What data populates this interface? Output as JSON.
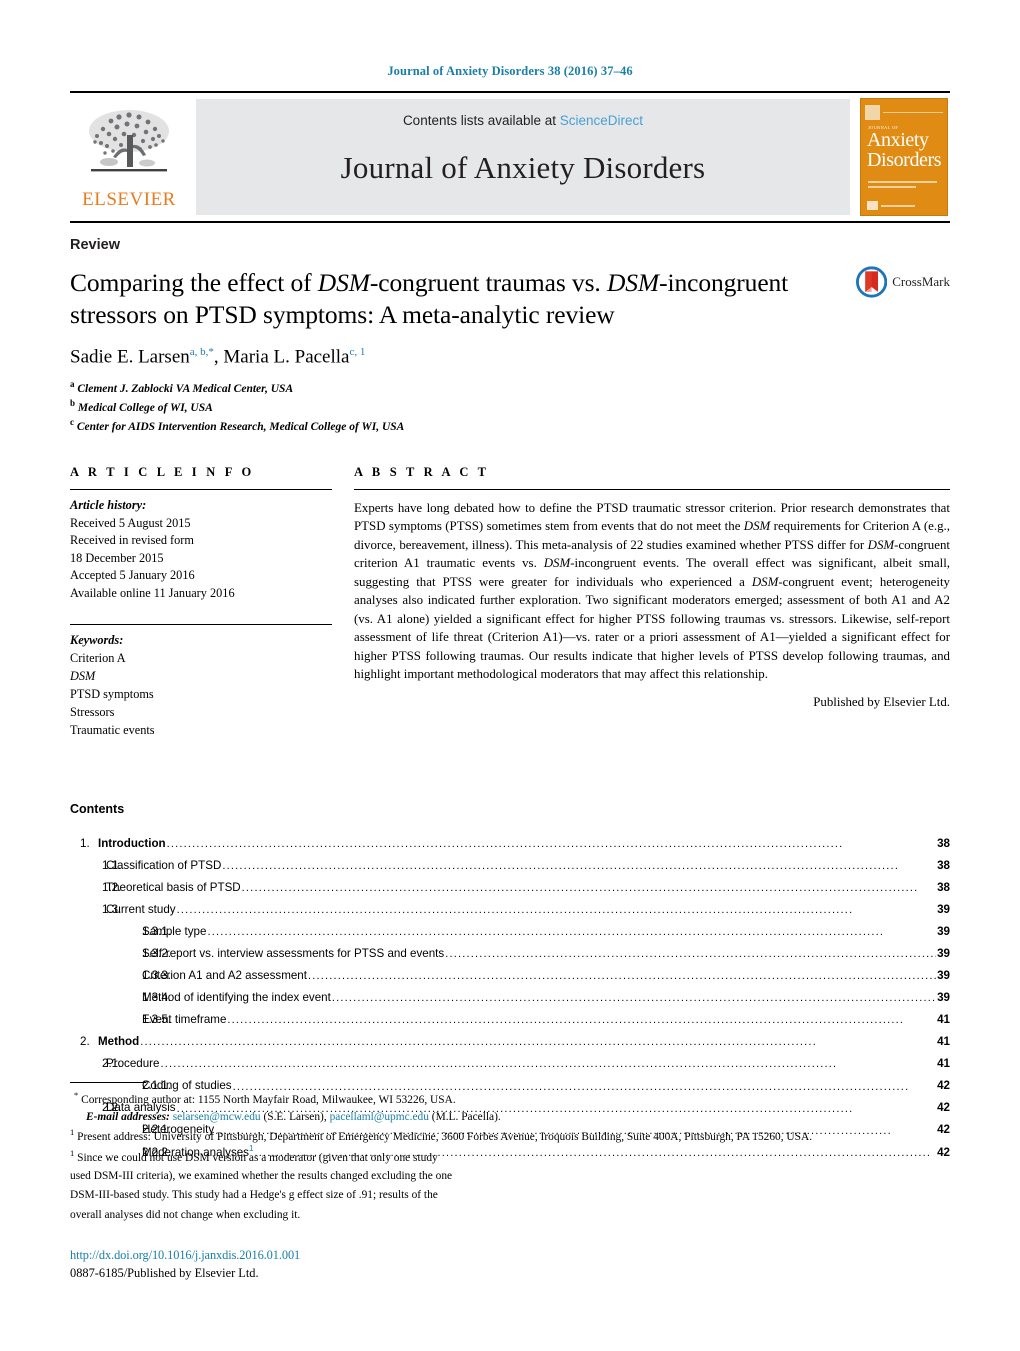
{
  "running_head": "Journal of Anxiety Disorders 38 (2016) 37–46",
  "masthead": {
    "publisher_name": "ELSEVIER",
    "contents_prefix": "Contents lists available at ",
    "sciencedirect": "ScienceDirect",
    "journal_name": "Journal of Anxiety Disorders",
    "cover": {
      "overline": "JOURNAL OF",
      "line1": "Anxiety",
      "line2": "Disorders"
    }
  },
  "article": {
    "type": "Review",
    "title_part1": "Comparing the effect of ",
    "title_dsm1": "DSM",
    "title_part2": "-congruent traumas vs. ",
    "title_dsm2": "DSM",
    "title_part3": "-incongruent stressors on PTSD symptoms: A meta-analytic review",
    "author1": "Sadie E. Larsen",
    "author1_sup": "a, b,",
    "author1_star": "*",
    "author_sep": ", ",
    "author2": "Maria L. Pacella",
    "author2_sup": "c, 1",
    "affiliations": [
      {
        "marker": "a",
        "text": "Clement J. Zablocki VA Medical Center, USA"
      },
      {
        "marker": "b",
        "text": "Medical College of WI, USA"
      },
      {
        "marker": "c",
        "text": "Center for AIDS Intervention Research, Medical College of WI, USA"
      }
    ],
    "crossmark_label": "CrossMark"
  },
  "article_info": {
    "heading": "A R T I C L E   I N F O",
    "history_label": "Article history:",
    "history": [
      "Received 5 August 2015",
      "Received in revised form",
      "18 December 2015",
      "Accepted 5 January 2016",
      "Available online 11 January 2016"
    ],
    "keywords_label": "Keywords:",
    "keywords": [
      "Criterion A",
      "DSM",
      "PTSD symptoms",
      "Stressors",
      "Traumatic events"
    ]
  },
  "abstract": {
    "heading": "A B S T R A C T",
    "p1": "Experts have long debated how to define the PTSD traumatic stressor criterion. Prior research demonstrates that PTSD symptoms (PTSS) sometimes stem from events that do not meet the ",
    "dsm1": "DSM",
    "p2": " requirements for Criterion A (e.g., divorce, bereavement, illness). This meta-analysis of 22 studies examined whether PTSS differ for ",
    "dsm2": "DSM",
    "p3": "-congruent criterion A1 traumatic events vs. ",
    "dsm3": "DSM",
    "p4": "-incongruent events. The overall effect was significant, albeit small, suggesting that PTSS were greater for individuals who experienced a ",
    "dsm4": "DSM",
    "p5": "-congruent event; heterogeneity analyses also indicated further exploration. Two significant moderators emerged; assessment of both A1 and A2 (vs. A1 alone) yielded a significant effect for higher PTSS following traumas vs. stressors. Likewise, self-report assessment of life threat (Criterion A1)—vs. rater or a priori assessment of A1—yielded a significant effect for higher PTSS following traumas. Our results indicate that higher levels of PTSS develop following traumas, and highlight important methodological moderators that may affect this relationship.",
    "published_by": "Published by Elsevier Ltd."
  },
  "contents": {
    "heading": "Contents",
    "items": [
      {
        "level": 1,
        "num": "1.",
        "label": "Introduction",
        "page": "38",
        "footnote": ""
      },
      {
        "level": 2,
        "num": "1.1.",
        "label": "Classification of PTSD",
        "page": "38",
        "footnote": ""
      },
      {
        "level": 2,
        "num": "1.2.",
        "label": "Theoretical basis of PTSD",
        "page": "38",
        "footnote": ""
      },
      {
        "level": 2,
        "num": "1.3.",
        "label": "Current study",
        "page": "39",
        "footnote": ""
      },
      {
        "level": 3,
        "num": "1.3.1.",
        "label": "Sample type",
        "page": "39",
        "footnote": ""
      },
      {
        "level": 3,
        "num": "1.3.2.",
        "label": "Self-report vs. interview assessments for PTSS and events",
        "page": "39",
        "footnote": ""
      },
      {
        "level": 3,
        "num": "1.3.3.",
        "label": "Criterion A1 and A2 assessment",
        "page": "39",
        "footnote": ""
      },
      {
        "level": 3,
        "num": "1.3.4.",
        "label": "Method of identifying the index event",
        "page": "39",
        "footnote": ""
      },
      {
        "level": 3,
        "num": "1.3.5.",
        "label": "Event timeframe",
        "page": "41",
        "footnote": ""
      },
      {
        "level": 1,
        "num": "2.",
        "label": "Method",
        "page": "41",
        "footnote": ""
      },
      {
        "level": 2,
        "num": "2.1.",
        "label": "Procedure",
        "page": "41",
        "footnote": ""
      },
      {
        "level": 3,
        "num": "2.1.1.",
        "label": "Coding of studies",
        "page": "42",
        "footnote": ""
      },
      {
        "level": 2,
        "num": "2.2.",
        "label": "Data analysis",
        "page": "42",
        "footnote": ""
      },
      {
        "level": 3,
        "num": "2.2.1.",
        "label": "Heterogeneity",
        "page": "42",
        "footnote": ""
      },
      {
        "level": 3,
        "num": "2.2.2.",
        "label": "Moderation analyses",
        "page": "42",
        "footnote": "1"
      }
    ]
  },
  "footnotes": {
    "corresponding_marker": "*",
    "corresponding": "Corresponding author at: 1155 North Mayfair Road, Milwaukee, WI 53226, USA.",
    "email_label": "E-mail addresses:",
    "email1": "selarsen@mcw.edu",
    "email1_name": " (S.E. Larsen),",
    "email2": "pacellaml@upmc.edu",
    "email2_name": " (M.L. Pacella).",
    "note1_marker": "1",
    "note1": "Present address: University of Pittsburgh, Department of Emergency Medicine, 3600 Forbes Avenue, Iroquois Building, Suite 400A, Pittsburgh, PA 15260, USA.",
    "note2_marker": "1",
    "note2_line1": "Since we could not use DSM version as a moderator (given that only one study",
    "note2_line2": "used DSM-III criteria), we examined whether the results changed excluding the one",
    "note2_line3": "DSM-III-based study. This study had a Hedge's g effect size of .91; results of the",
    "note2_line4": "overall analyses did not change when excluding it.",
    "doi": "http://dx.doi.org/10.1016/j.janxdis.2016.01.001",
    "issn": "0887-6185/Published by Elsevier Ltd."
  },
  "colors": {
    "link_blue": "#1a7fa8",
    "sciencedirect_blue": "#4a9fd4",
    "elsevier_orange": "#e87d1e",
    "cover_orange": "#e08b13",
    "banner_gray": "#e6e7e8"
  }
}
